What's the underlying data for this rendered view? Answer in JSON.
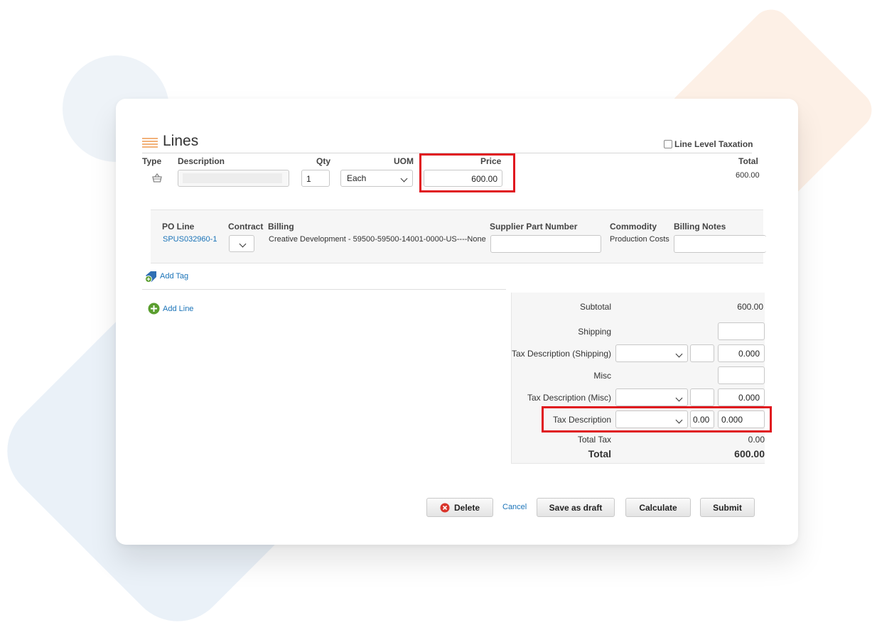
{
  "section": {
    "title": "Lines",
    "line_level_taxation": "Line Level Taxation"
  },
  "line_headers": {
    "type": "Type",
    "description": "Description",
    "qty": "Qty",
    "uom": "UOM",
    "price": "Price",
    "total": "Total"
  },
  "line": {
    "description": "",
    "qty": "1",
    "uom": "Each",
    "price": "600.00",
    "total": "600.00"
  },
  "detail_headers": {
    "po_line": "PO Line",
    "contract": "Contract",
    "billing": "Billing",
    "supplier_part_number": "Supplier Part Number",
    "commodity": "Commodity",
    "billing_notes": "Billing Notes"
  },
  "detail": {
    "po_line": "SPUS032960-1",
    "billing": "Creative Development - 59500-59500-14001-0000-US----None",
    "supplier_part_number": "",
    "commodity": "Production Costs",
    "billing_notes": ""
  },
  "actions": {
    "add_tag": "Add Tag",
    "add_line": "Add Line"
  },
  "totals": {
    "subtotal_label": "Subtotal",
    "subtotal": "600.00",
    "shipping_label": "Shipping",
    "shipping": "",
    "tax_shipping_label": "Tax Description (Shipping)",
    "tax_shipping_rate": "",
    "tax_shipping_amount": "0.000",
    "misc_label": "Misc",
    "misc": "",
    "tax_misc_label": "Tax Description (Misc)",
    "tax_misc_rate": "",
    "tax_misc_amount": "0.000",
    "tax_label": "Tax Description",
    "tax_rate": "0.00",
    "tax_amount": "0.000",
    "total_tax_label": "Total Tax",
    "total_tax": "0.00",
    "total_label": "Total",
    "total": "600.00"
  },
  "buttons": {
    "delete": "Delete",
    "cancel": "Cancel",
    "save_draft": "Save as draft",
    "calculate": "Calculate",
    "submit": "Submit"
  },
  "colors": {
    "highlight": "#e0161e",
    "link": "#1a73b8",
    "add_green": "#5a9e2f",
    "delete_red": "#d9342b"
  },
  "icons": [
    "lines-section-icon",
    "basket-icon",
    "tag-add-icon",
    "plus-circle-icon",
    "delete-x-icon",
    "chevron-down-icon"
  ]
}
